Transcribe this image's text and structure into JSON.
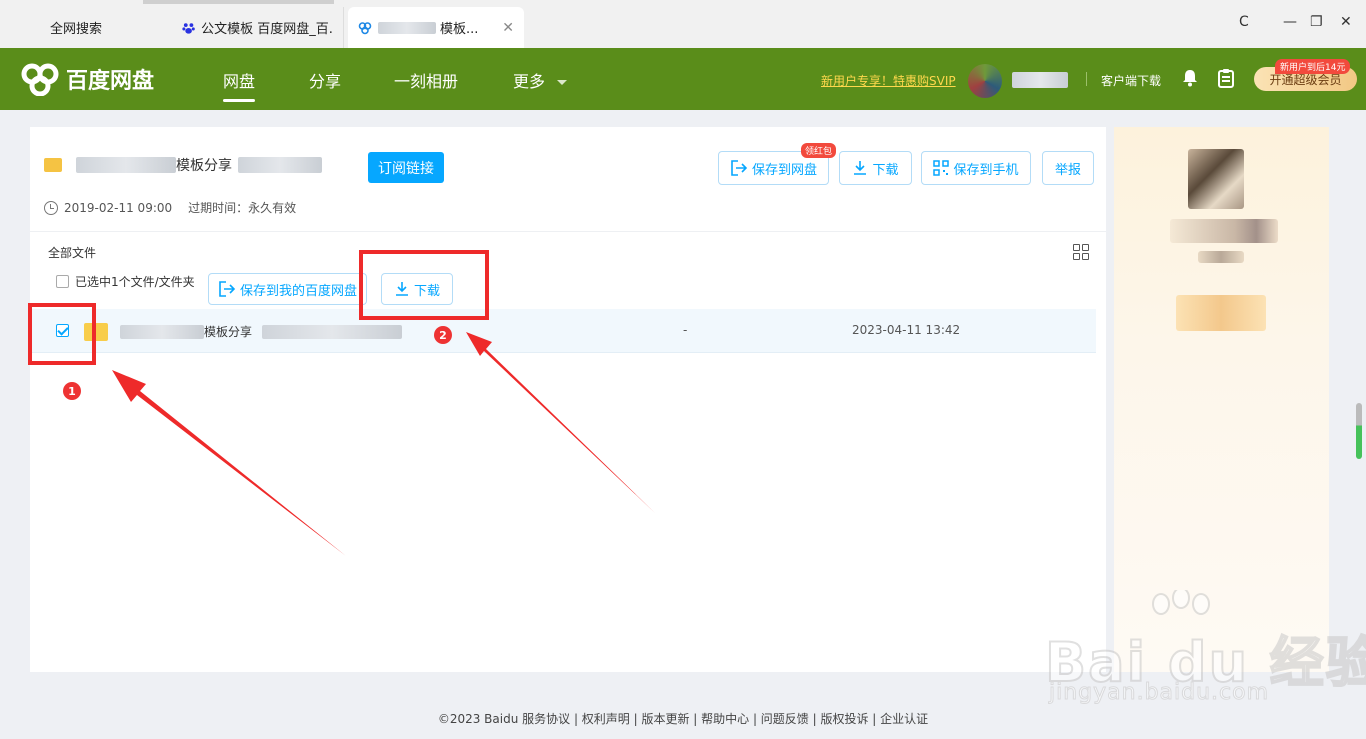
{
  "browser": {
    "search_tab": "全网搜索",
    "tab1_title": "公文模板 百度网盘_百...",
    "tab2_title_suffix": "模板...",
    "tab_close": "✕",
    "ctrl_reload": "C",
    "ctrl_minimize": "—",
    "ctrl_restore": "❐",
    "ctrl_close": "✕"
  },
  "header": {
    "logo_text": "百度网盘",
    "nav": [
      "网盘",
      "分享",
      "一刻相册",
      "更多"
    ],
    "promo": "新用户专享！特惠购SVIP",
    "client_download": "客户端下载",
    "vip_button": "开通超级会员",
    "vip_badge": "新用户到后14元"
  },
  "share": {
    "title_suffix": "模板分享",
    "subscribe_button": "订阅链接",
    "save_to_pan": "保存到网盘",
    "red_packet_badge": "领红包",
    "download": "下载",
    "save_to_phone": "保存到手机",
    "report": "举报",
    "date": "2019-02-11 09:00",
    "expire": "过期时间：永久有效"
  },
  "files": {
    "breadcrumb": "全部文件",
    "selected_text": "已选中1个文件/文件夹",
    "save_to_my_pan": "保存到我的百度网盘",
    "download": "下载",
    "rows": [
      {
        "name_suffix": "模板分享",
        "size": "-",
        "date": "2023-04-11 13:42",
        "checked": true
      }
    ]
  },
  "annotations": {
    "marker1": "1",
    "marker2": "2"
  },
  "footer": {
    "text": "©2023 Baidu  服务协议 | 权利声明 | 版本更新 | 帮助中心 | 问题反馈 | 版权投诉 | 企业认证"
  },
  "watermark": {
    "brand": "Bai du 经验",
    "url": "jingyan.baidu.com"
  },
  "colors": {
    "header_green": "#5a8d1a",
    "accent_blue": "#06a7ff",
    "annotation_red": "#ee2a2a"
  }
}
